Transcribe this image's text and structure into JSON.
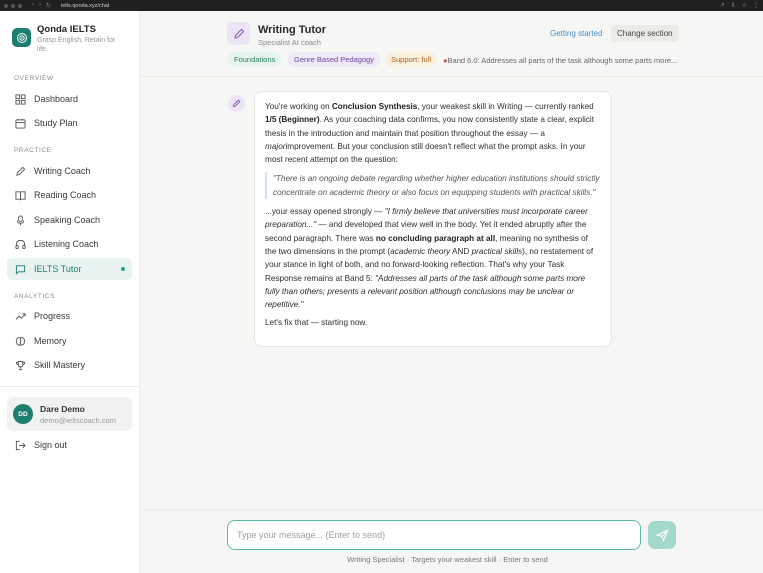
{
  "browser": {
    "url": "ielts.qonda.xyz/chat"
  },
  "brand": {
    "name": "Qonda IELTS",
    "tagline": "Grasp English, Retain for life."
  },
  "sidebar": {
    "sections": [
      {
        "label": "OVERVIEW"
      },
      {
        "label": "PRACTICE"
      },
      {
        "label": "ANALYTICS"
      }
    ],
    "items": [
      {
        "label": "Dashboard",
        "icon": "grid-icon"
      },
      {
        "label": "Study Plan",
        "icon": "calendar-icon"
      },
      {
        "label": "Writing Coach",
        "icon": "pen-icon"
      },
      {
        "label": "Reading Coach",
        "icon": "book-icon"
      },
      {
        "label": "Speaking Coach",
        "icon": "mic-icon"
      },
      {
        "label": "Listening Coach",
        "icon": "headphones-icon"
      },
      {
        "label": "IELTS Tutor",
        "icon": "chat-icon",
        "active": true
      },
      {
        "label": "Progress",
        "icon": "trend-icon"
      },
      {
        "label": "Memory",
        "icon": "brain-icon"
      },
      {
        "label": "Skill Mastery",
        "icon": "trophy-icon"
      }
    ],
    "user": {
      "initials": "DD",
      "name": "Dare Demo",
      "email": "demo@ieltscoach.com"
    },
    "signout_label": "Sign out"
  },
  "header": {
    "title": "Writing Tutor",
    "subtitle": "Specialist AI coach",
    "getting_started": "Getting started",
    "change_section": "Change section",
    "chips": [
      {
        "label": "Foundations",
        "color": "#2b7a5a"
      },
      {
        "label": "Genre Based Pedagogy",
        "color": "#6b4a9a"
      },
      {
        "label": "Support: full",
        "color": "#a8651c"
      }
    ],
    "band_note": "Band 6.0: Addresses all parts of the task although some parts more..."
  },
  "message": {
    "p1_a": "You're working on ",
    "p1_b": "Conclusion Synthesis",
    "p1_c": ", your weakest skill in Writing — currently ranked ",
    "p1_d": "1/5 (Beginner)",
    "p1_e": ". As your coaching data confirms, you now consistently state a clear, explicit thesis in the introduction and maintain that position throughout the essay — a ",
    "p1_f": "major",
    "p1_g": "improvement. But your conclusion still doesn't reflect what the prompt asks. In your most recent attempt on the question:",
    "quote": "\"There is an ongoing debate regarding whether higher education institutions should strictly concentrate on academic theory or also focus on equipping students with practical skills.\"",
    "p2_a": "...your essay opened strongly — ",
    "p2_b": "\"I firmly believe that universities must incorporate career preparation...\"",
    "p2_c": " — and developed that view well in the body. Yet it ended abruptly after the second paragraph. There was ",
    "p2_d": "no concluding paragraph at all",
    "p2_e": ", meaning no synthesis of the two dimensions in the prompt (",
    "p2_f": "academic theory",
    "p2_g": " AND ",
    "p2_h": "practical skills",
    "p2_i": "), no restatement of your stance in light of both, and no forward-looking reflection. That's why your Task Response remains at Band 5: ",
    "p2_j": "\"Addresses all parts of the task although some parts more fully than others; presents a relevant position although conclusions may be unclear or repetitive.\"",
    "p3": "Let's fix that — starting now."
  },
  "composer": {
    "placeholder": "Type your message... (Enter to send)",
    "hint": "Writing Specialist · Targets your weakest skill · Enter to send"
  },
  "colors": {
    "accent": "#1d7d6f",
    "composer_border": "#5bb9a8",
    "send_button": "#a3d8cd"
  }
}
